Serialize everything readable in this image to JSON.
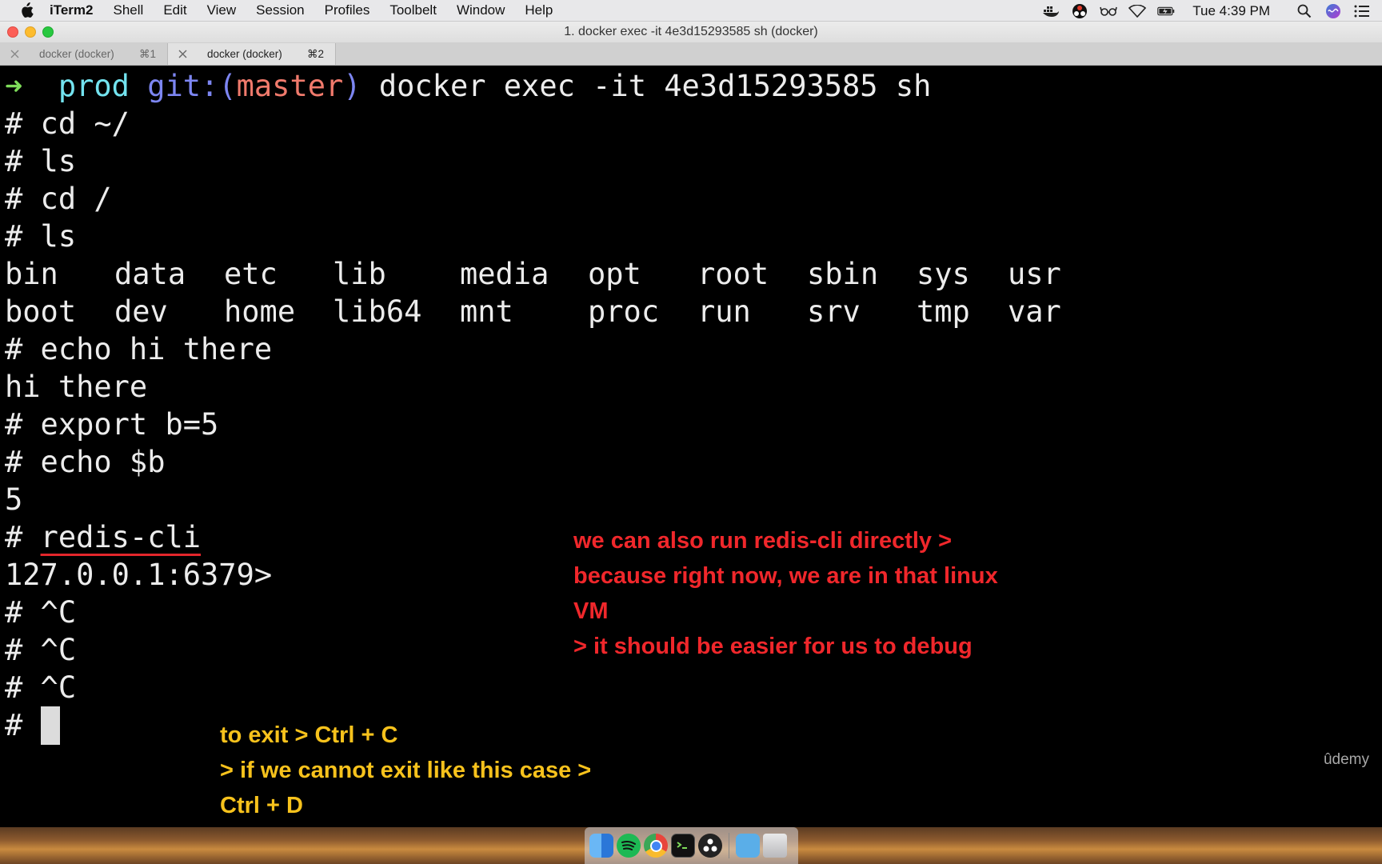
{
  "menubar": {
    "app_name": "iTerm2",
    "items": [
      "Shell",
      "Edit",
      "View",
      "Session",
      "Profiles",
      "Toolbelt",
      "Window",
      "Help"
    ],
    "clock": "Tue 4:39 PM"
  },
  "window": {
    "title": "1. docker exec -it 4e3d15293585 sh (docker)"
  },
  "tabs": [
    {
      "label": "docker (docker)",
      "shortcut": "⌘1"
    },
    {
      "label": "docker (docker)",
      "shortcut": "⌘2"
    }
  ],
  "terminal": {
    "prompt": {
      "arrow": "➜",
      "dir": "prod",
      "git_prefix": "git:(",
      "branch": "master",
      "git_suffix": ")",
      "command": "docker exec -it 4e3d15293585 sh"
    },
    "lines": [
      "# cd ~/",
      "# ls",
      "# cd /",
      "# ls"
    ],
    "ls_row1": [
      "bin",
      "data",
      "etc",
      "lib",
      "media",
      "opt",
      "root",
      "sbin",
      "sys",
      "usr"
    ],
    "ls_row2": [
      "boot",
      "dev",
      "home",
      "lib64",
      "mnt",
      "proc",
      "run",
      "srv",
      "tmp",
      "var"
    ],
    "lines2": [
      "# echo hi there",
      "hi there",
      "# export b=5",
      "# echo $b",
      "5"
    ],
    "redis_hash": "# ",
    "redis_cmd": "redis-cli",
    "redis_prompt": "127.0.0.1:6379>",
    "lines3": [
      "# ^C",
      "# ^C",
      "# ^C"
    ],
    "last_prompt": "# "
  },
  "annotations": {
    "red": "we can also run redis-cli directly >\nbecause right now, we are in that linux\nVM\n> it should be easier for us to debug",
    "yellow": "to exit > Ctrl + C\n> if we cannot exit like this case >\nCtrl + D"
  },
  "watermark": "ûdemy",
  "colors": {
    "annotation_red": "#f0272b",
    "annotation_yellow": "#f7c21c",
    "prompt_arrow": "#7edc5a",
    "prompt_dir": "#73e3ef",
    "git": "#7d86f2",
    "branch": "#f07a6c"
  }
}
